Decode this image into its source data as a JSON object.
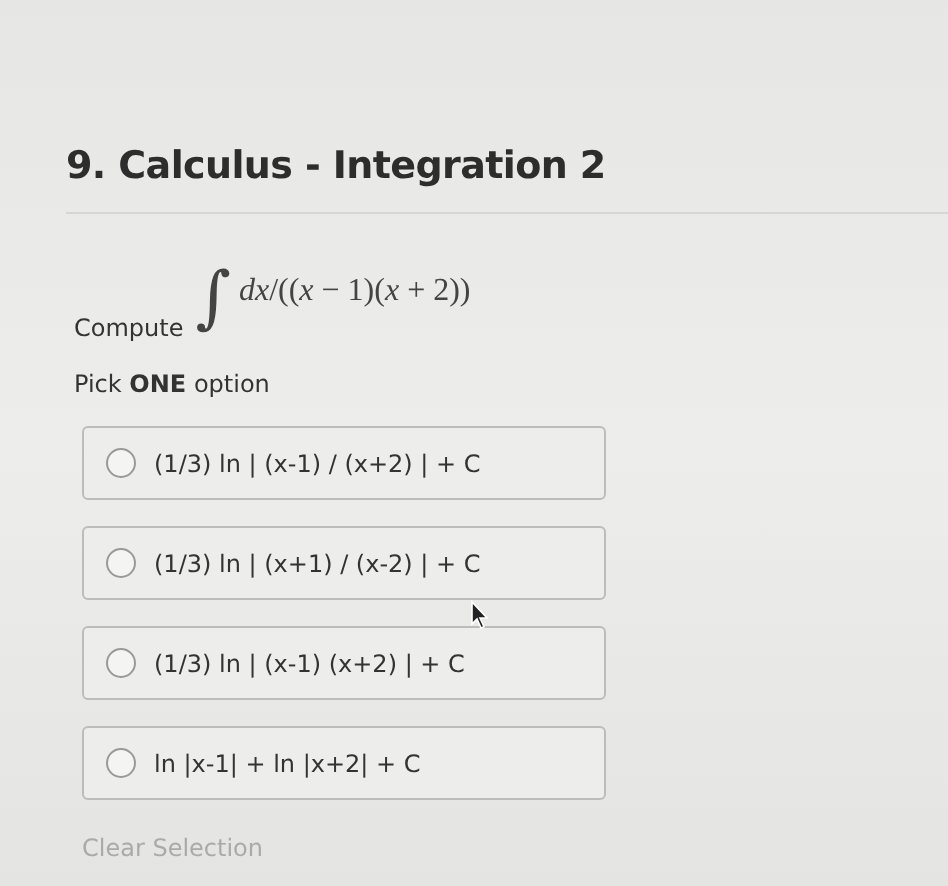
{
  "question": {
    "title": "9. Calculus - Integration 2",
    "prompt": "Compute",
    "integral_sign": "∫",
    "formula": "*dx*/((*x* − 1)(*x* + 2))",
    "instruction": "Pick **ONE** option"
  },
  "options": [
    {
      "label": "(1/3) ln | (x-1) / (x+2) | + C",
      "selected": false
    },
    {
      "label": "(1/3) ln | (x+1) / (x-2) | + C",
      "selected": false
    },
    {
      "label": "(1/3) ln | (x-1) (x+2) | + C",
      "selected": false
    },
    {
      "label": "ln |x-1| + ln |x+2| + C",
      "selected": false
    }
  ],
  "clear_selection": "Clear Selection"
}
